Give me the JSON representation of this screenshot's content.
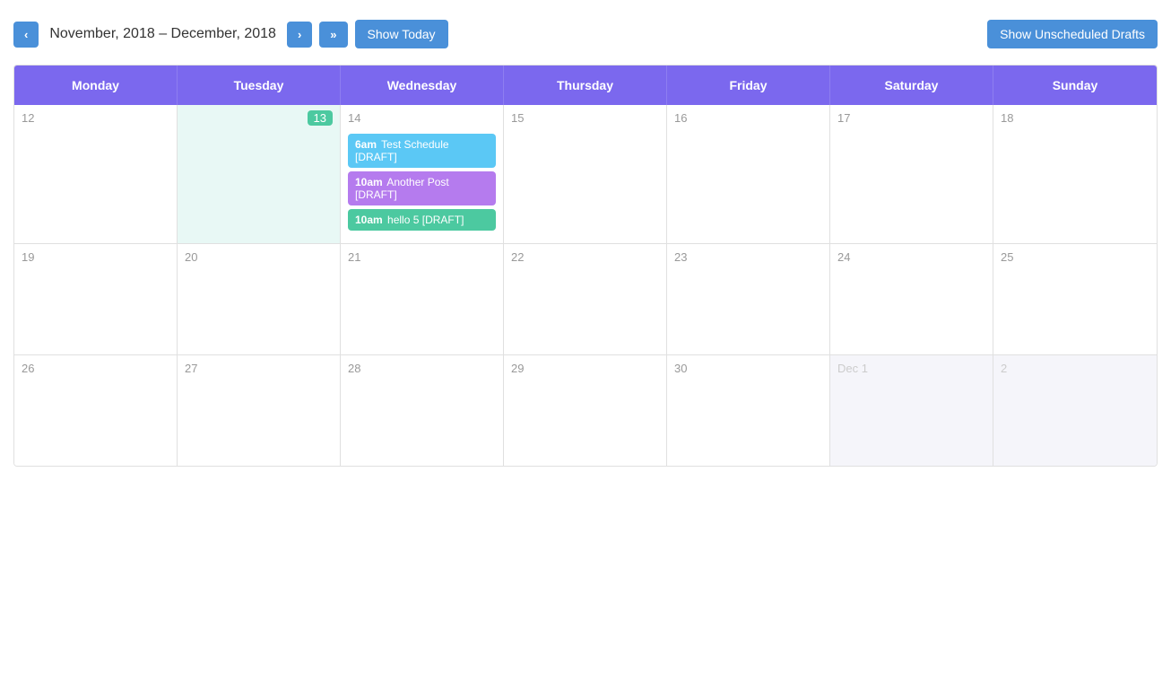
{
  "toolbar": {
    "prev_label": "‹",
    "prev_prev_label": "«",
    "next_label": "›",
    "next_next_label": "»",
    "date_range": "November, 2018 – December, 2018",
    "show_today_label": "Show Today",
    "show_drafts_label": "Show Unscheduled Drafts"
  },
  "calendar": {
    "days": [
      "Monday",
      "Tuesday",
      "Wednesday",
      "Thursday",
      "Friday",
      "Saturday",
      "Sunday"
    ],
    "weeks": [
      {
        "dates": [
          12,
          13,
          14,
          15,
          16,
          17,
          18
        ],
        "today_index": 1,
        "dim": [],
        "events_by_day": {
          "2": [
            {
              "time": "6am",
              "title": "Test Schedule [DRAFT]",
              "color": "event-blue"
            },
            {
              "time": "10am",
              "title": "Another Post [DRAFT]",
              "color": "event-purple"
            },
            {
              "time": "10am",
              "title": "hello 5 [DRAFT]",
              "color": "event-teal"
            }
          ]
        }
      },
      {
        "dates": [
          19,
          20,
          21,
          22,
          23,
          24,
          25
        ],
        "today_index": -1,
        "dim": [],
        "events_by_day": {}
      },
      {
        "dates": [
          26,
          27,
          28,
          29,
          30,
          "Dec 1",
          2
        ],
        "today_index": -1,
        "dim": [
          5,
          6
        ],
        "events_by_day": {}
      }
    ]
  }
}
